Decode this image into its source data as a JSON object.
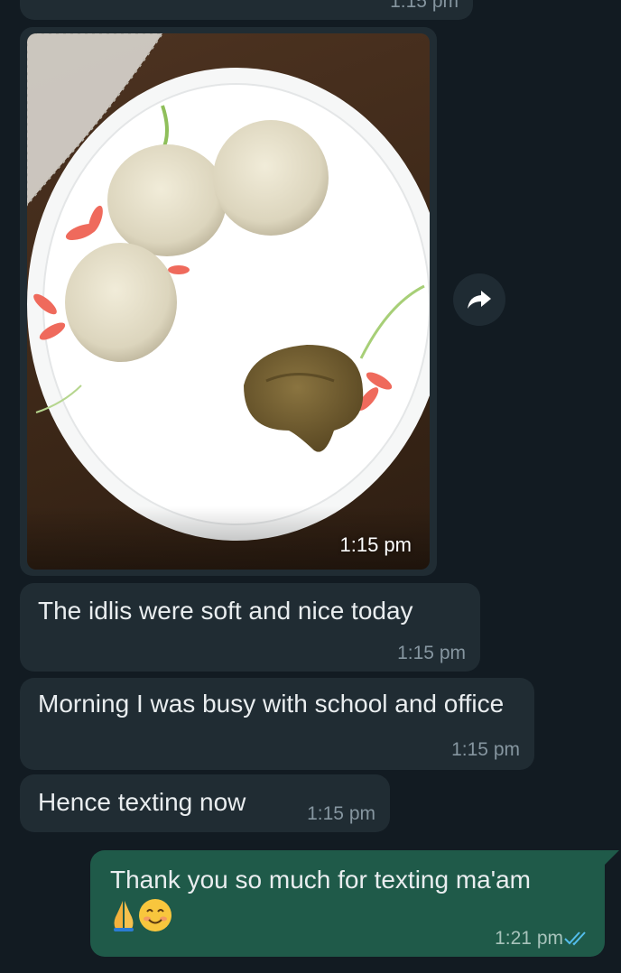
{
  "messages": [
    {
      "id": "prev",
      "direction": "incoming",
      "time": "1:15 pm"
    },
    {
      "id": "image",
      "direction": "incoming",
      "type": "photo",
      "time": "1:15 pm"
    },
    {
      "id": "m1",
      "direction": "incoming",
      "text": "The idlis were soft and nice today",
      "time": "1:15 pm"
    },
    {
      "id": "m2",
      "direction": "incoming",
      "text": "Morning I was busy with school and office",
      "time": "1:15 pm"
    },
    {
      "id": "m3",
      "direction": "incoming",
      "text": "Hence texting now",
      "time": "1:15 pm"
    },
    {
      "id": "m4",
      "direction": "outgoing",
      "text": "Thank you so much for texting ma'am",
      "emojis": [
        "folded-hands",
        "smiling-face"
      ],
      "time": "1:21 pm",
      "status": "read"
    }
  ],
  "icons": {
    "forward": "forward-arrow-icon",
    "read_status": "double-check-icon"
  },
  "colors": {
    "background": "#121b22",
    "incoming_bubble": "#202c33",
    "outgoing_bubble": "#1f5a49",
    "timestamp": "#8696a0",
    "read_ticks": "#53bdeb"
  }
}
